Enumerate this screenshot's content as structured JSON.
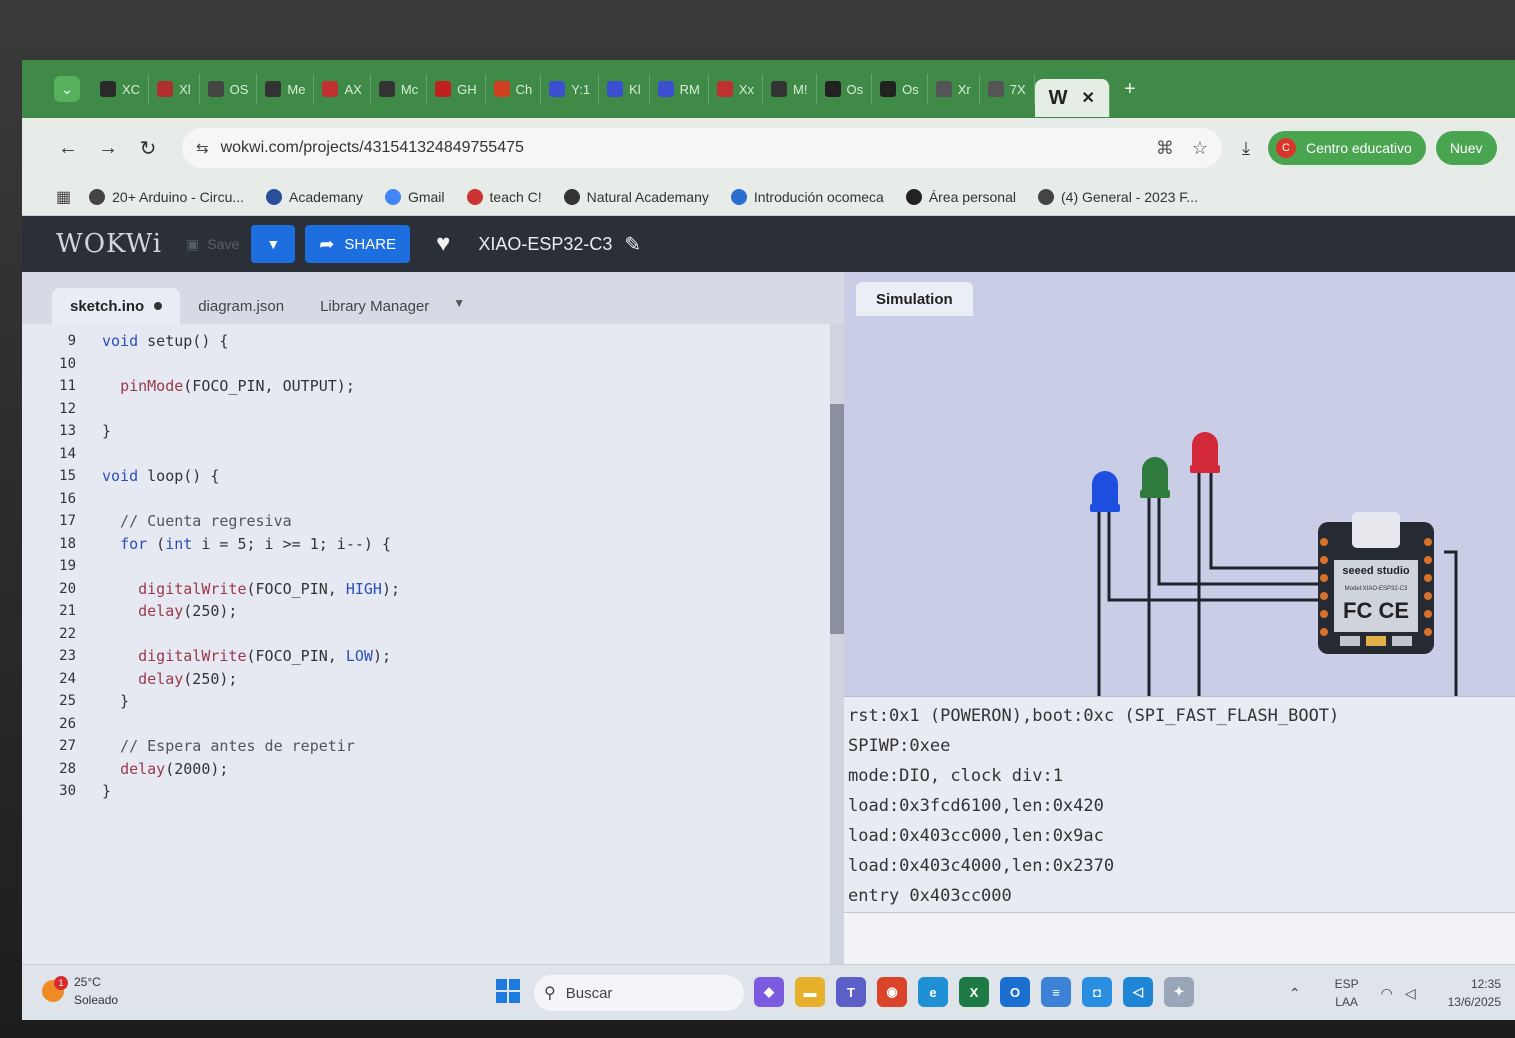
{
  "browser": {
    "tabs": [
      {
        "label": "XC",
        "icon": "whatsapp-icon",
        "color": "#2a2a2a"
      },
      {
        "label": "Xl",
        "icon": "grid-icon",
        "color": "#b03030"
      },
      {
        "label": "OS",
        "icon": "diamond-icon",
        "color": "#444"
      },
      {
        "label": "Me",
        "icon": "drone-icon",
        "color": "#333"
      },
      {
        "label": "AX",
        "icon": "mail-icon",
        "color": "#c03030"
      },
      {
        "label": "Mc",
        "icon": "bot-icon",
        "color": "#333"
      },
      {
        "label": "GH",
        "icon": "shield-icon",
        "color": "#c02020"
      },
      {
        "label": "Ch",
        "icon": "drive-icon",
        "color": "#d04020"
      },
      {
        "label": "Y:1",
        "icon": "forms-icon",
        "color": "#3b4fd0"
      },
      {
        "label": "Kl",
        "icon": "forms-icon",
        "color": "#3b4fd0"
      },
      {
        "label": "RM",
        "icon": "forms-icon",
        "color": "#3b4fd0"
      },
      {
        "label": "Xx",
        "icon": "gmail-icon",
        "color": "#c03030"
      },
      {
        "label": "M!",
        "icon": "drone-icon",
        "color": "#333"
      },
      {
        "label": "Os",
        "icon": "openai-icon",
        "color": "#222"
      },
      {
        "label": "Os",
        "icon": "openai-icon",
        "color": "#222"
      },
      {
        "label": "Xr",
        "icon": "tz-icon",
        "color": "#555"
      },
      {
        "label": "7X",
        "icon": "globe-icon",
        "color": "#555"
      }
    ],
    "active_tab": {
      "label": "W",
      "close": "✕"
    },
    "new_tab": "+",
    "url": "wokwi.com/projects/431541324849755475",
    "profile_label": "Centro educativo",
    "profile_initial": "C",
    "nuevo_label": "Nuev",
    "bookmarks": [
      {
        "label": "20+ Arduino - Circu...",
        "color": "#444",
        "icon": "arduino-icon"
      },
      {
        "label": "Academany",
        "color": "#2a4f9a",
        "icon": "academany-icon"
      },
      {
        "label": "Gmail",
        "color": "#4285f4",
        "icon": "google-icon"
      },
      {
        "label": "teach C!",
        "color": "#c33",
        "icon": "teach-icon"
      },
      {
        "label": "Natural Academany",
        "color": "#333",
        "icon": "natural-icon"
      },
      {
        "label": "Introdución ocomeca",
        "color": "#2a6fd0",
        "icon": "intro-icon"
      },
      {
        "label": "Área personal",
        "color": "#222",
        "icon": "u-icon"
      },
      {
        "label": "(4) General - 2023 F...",
        "color": "#444",
        "icon": "general-icon"
      }
    ]
  },
  "wokwi": {
    "logo": "WOKWi",
    "save_label": "Save",
    "share_label": "SHARE",
    "project_title": "XIAO-ESP32-C3"
  },
  "editor": {
    "tabs": [
      "sketch.ino",
      "diagram.json",
      "Library Manager"
    ],
    "lines": [
      {
        "n": "9",
        "text": "void setup() {"
      },
      {
        "n": "10",
        "text": ""
      },
      {
        "n": "11",
        "text": "  pinMode(FOCO_PIN, OUTPUT);"
      },
      {
        "n": "12",
        "text": ""
      },
      {
        "n": "13",
        "text": "}"
      },
      {
        "n": "14",
        "text": ""
      },
      {
        "n": "15",
        "text": "void loop() {"
      },
      {
        "n": "16",
        "text": ""
      },
      {
        "n": "17",
        "text": "  // Cuenta regresiva"
      },
      {
        "n": "18",
        "text": "  for (int i = 5; i >= 1; i--) {"
      },
      {
        "n": "19",
        "text": ""
      },
      {
        "n": "20",
        "text": "    digitalWrite(FOCO_PIN, HIGH);"
      },
      {
        "n": "21",
        "text": "    delay(250);"
      },
      {
        "n": "22",
        "text": ""
      },
      {
        "n": "23",
        "text": "    digitalWrite(FOCO_PIN, LOW);"
      },
      {
        "n": "24",
        "text": "    delay(250);"
      },
      {
        "n": "25",
        "text": "  }"
      },
      {
        "n": "26",
        "text": ""
      },
      {
        "n": "27",
        "text": "  // Espera antes de repetir"
      },
      {
        "n": "28",
        "text": "  delay(2000);"
      },
      {
        "n": "30",
        "text": "}"
      }
    ]
  },
  "simulation": {
    "tab_label": "Simulation",
    "board_brand": "seeed studio",
    "board_model": "Model:XIAO-ESP32-C3",
    "board_marks": "FC CE",
    "led_colors": [
      "#1f4fe0",
      "#2f7a3d",
      "#d2283a"
    ],
    "console": [
      "rst:0x1 (POWERON),boot:0xc (SPI_FAST_FLASH_BOOT)",
      "SPIWP:0xee",
      "mode:DIO, clock div:1",
      "load:0x3fcd6100,len:0x420",
      "load:0x403cc000,len:0x9ac",
      "load:0x403c4000,len:0x2370",
      "entry 0x403cc000"
    ]
  },
  "taskbar": {
    "weather_temp": "25°C",
    "weather_desc": "Soleado",
    "weather_badge": "1",
    "search_placeholder": "Buscar",
    "apps": [
      {
        "name": "copilot-icon",
        "color": "#7b5be0",
        "glyph": "◆"
      },
      {
        "name": "folder-icon",
        "color": "#e6b02a",
        "glyph": "▬"
      },
      {
        "name": "teams-icon",
        "color": "#5b5fc7",
        "glyph": "T"
      },
      {
        "name": "chrome-icon",
        "color": "#d9442b",
        "glyph": "◉"
      },
      {
        "name": "edge-icon",
        "color": "#1f8fd6",
        "glyph": "e"
      },
      {
        "name": "excel-icon",
        "color": "#1d7a44",
        "glyph": "X"
      },
      {
        "name": "outlook-icon",
        "color": "#1a6fd1",
        "glyph": "O"
      },
      {
        "name": "notepad-icon",
        "color": "#3b82d6",
        "glyph": "≡"
      },
      {
        "name": "store-icon",
        "color": "#2a8fe0",
        "glyph": "◘"
      },
      {
        "name": "vscode-icon",
        "color": "#1f86d6",
        "glyph": "◁"
      },
      {
        "name": "pinned-icon",
        "color": "#9aa6b8",
        "glyph": "✦"
      }
    ],
    "lang_top": "ESP",
    "lang_bottom": "LAA",
    "time": "12:35",
    "date": "13/6/2025"
  }
}
